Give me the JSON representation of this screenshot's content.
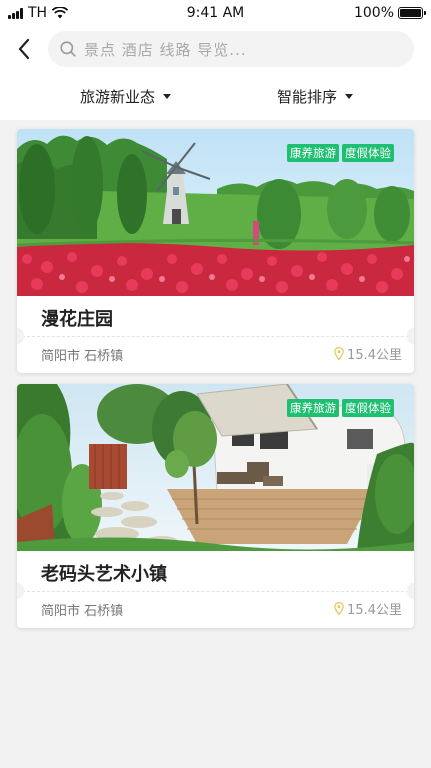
{
  "status_bar": {
    "carrier": "TH",
    "time": "9:41 AM",
    "battery": "100%",
    "battery_level": 1.0
  },
  "header": {
    "back_icon": "chevron-left-icon",
    "search_icon": "search-icon",
    "search_placeholder": "景点 酒店 线路 导览..."
  },
  "filters": [
    {
      "label": "旅游新业态",
      "icon": "caret-down-icon"
    },
    {
      "label": "智能排序",
      "icon": "caret-down-icon"
    }
  ],
  "listings": [
    {
      "name": "漫花庄园",
      "tags": [
        "康养旅游",
        "度假体验"
      ],
      "location": "简阳市 石桥镇",
      "distance": "15.4公里",
      "image": "windmill-flower-garden-photo"
    },
    {
      "name": "老码头艺术小镇",
      "tags": [
        "康养旅游",
        "度假体验"
      ],
      "location": "简阳市 石桥镇",
      "distance": "15.4公里",
      "image": "rv-camper-garden-photo"
    }
  ],
  "colors": {
    "tag_green": "#1fbf72",
    "pin_yellow": "#e9c75a",
    "background": "#f2f2f2"
  }
}
